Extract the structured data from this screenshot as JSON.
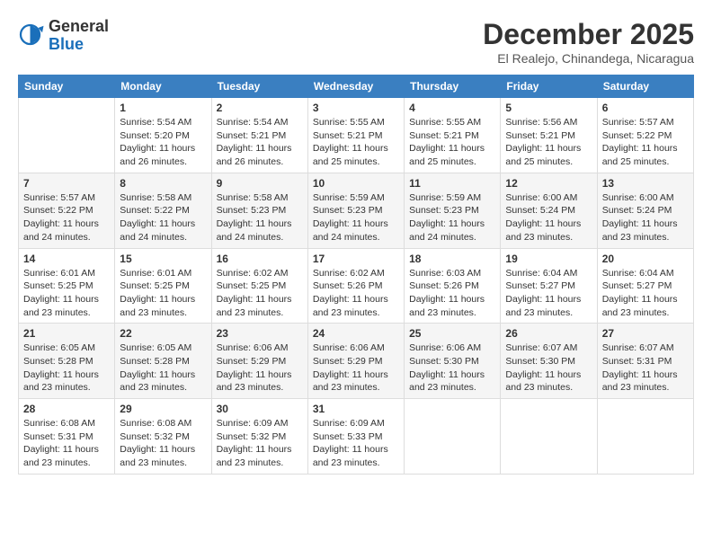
{
  "header": {
    "logo": {
      "general": "General",
      "blue": "Blue"
    },
    "title": "December 2025",
    "location": "El Realejo, Chinandega, Nicaragua"
  },
  "weekdays": [
    "Sunday",
    "Monday",
    "Tuesday",
    "Wednesday",
    "Thursday",
    "Friday",
    "Saturday"
  ],
  "weeks": [
    [
      {
        "day": "",
        "info": ""
      },
      {
        "day": "1",
        "info": "Sunrise: 5:54 AM\nSunset: 5:20 PM\nDaylight: 11 hours\nand 26 minutes."
      },
      {
        "day": "2",
        "info": "Sunrise: 5:54 AM\nSunset: 5:21 PM\nDaylight: 11 hours\nand 26 minutes."
      },
      {
        "day": "3",
        "info": "Sunrise: 5:55 AM\nSunset: 5:21 PM\nDaylight: 11 hours\nand 25 minutes."
      },
      {
        "day": "4",
        "info": "Sunrise: 5:55 AM\nSunset: 5:21 PM\nDaylight: 11 hours\nand 25 minutes."
      },
      {
        "day": "5",
        "info": "Sunrise: 5:56 AM\nSunset: 5:21 PM\nDaylight: 11 hours\nand 25 minutes."
      },
      {
        "day": "6",
        "info": "Sunrise: 5:57 AM\nSunset: 5:22 PM\nDaylight: 11 hours\nand 25 minutes."
      }
    ],
    [
      {
        "day": "7",
        "info": "Sunrise: 5:57 AM\nSunset: 5:22 PM\nDaylight: 11 hours\nand 24 minutes."
      },
      {
        "day": "8",
        "info": "Sunrise: 5:58 AM\nSunset: 5:22 PM\nDaylight: 11 hours\nand 24 minutes."
      },
      {
        "day": "9",
        "info": "Sunrise: 5:58 AM\nSunset: 5:23 PM\nDaylight: 11 hours\nand 24 minutes."
      },
      {
        "day": "10",
        "info": "Sunrise: 5:59 AM\nSunset: 5:23 PM\nDaylight: 11 hours\nand 24 minutes."
      },
      {
        "day": "11",
        "info": "Sunrise: 5:59 AM\nSunset: 5:23 PM\nDaylight: 11 hours\nand 24 minutes."
      },
      {
        "day": "12",
        "info": "Sunrise: 6:00 AM\nSunset: 5:24 PM\nDaylight: 11 hours\nand 23 minutes."
      },
      {
        "day": "13",
        "info": "Sunrise: 6:00 AM\nSunset: 5:24 PM\nDaylight: 11 hours\nand 23 minutes."
      }
    ],
    [
      {
        "day": "14",
        "info": "Sunrise: 6:01 AM\nSunset: 5:25 PM\nDaylight: 11 hours\nand 23 minutes."
      },
      {
        "day": "15",
        "info": "Sunrise: 6:01 AM\nSunset: 5:25 PM\nDaylight: 11 hours\nand 23 minutes."
      },
      {
        "day": "16",
        "info": "Sunrise: 6:02 AM\nSunset: 5:25 PM\nDaylight: 11 hours\nand 23 minutes."
      },
      {
        "day": "17",
        "info": "Sunrise: 6:02 AM\nSunset: 5:26 PM\nDaylight: 11 hours\nand 23 minutes."
      },
      {
        "day": "18",
        "info": "Sunrise: 6:03 AM\nSunset: 5:26 PM\nDaylight: 11 hours\nand 23 minutes."
      },
      {
        "day": "19",
        "info": "Sunrise: 6:04 AM\nSunset: 5:27 PM\nDaylight: 11 hours\nand 23 minutes."
      },
      {
        "day": "20",
        "info": "Sunrise: 6:04 AM\nSunset: 5:27 PM\nDaylight: 11 hours\nand 23 minutes."
      }
    ],
    [
      {
        "day": "21",
        "info": "Sunrise: 6:05 AM\nSunset: 5:28 PM\nDaylight: 11 hours\nand 23 minutes."
      },
      {
        "day": "22",
        "info": "Sunrise: 6:05 AM\nSunset: 5:28 PM\nDaylight: 11 hours\nand 23 minutes."
      },
      {
        "day": "23",
        "info": "Sunrise: 6:06 AM\nSunset: 5:29 PM\nDaylight: 11 hours\nand 23 minutes."
      },
      {
        "day": "24",
        "info": "Sunrise: 6:06 AM\nSunset: 5:29 PM\nDaylight: 11 hours\nand 23 minutes."
      },
      {
        "day": "25",
        "info": "Sunrise: 6:06 AM\nSunset: 5:30 PM\nDaylight: 11 hours\nand 23 minutes."
      },
      {
        "day": "26",
        "info": "Sunrise: 6:07 AM\nSunset: 5:30 PM\nDaylight: 11 hours\nand 23 minutes."
      },
      {
        "day": "27",
        "info": "Sunrise: 6:07 AM\nSunset: 5:31 PM\nDaylight: 11 hours\nand 23 minutes."
      }
    ],
    [
      {
        "day": "28",
        "info": "Sunrise: 6:08 AM\nSunset: 5:31 PM\nDaylight: 11 hours\nand 23 minutes."
      },
      {
        "day": "29",
        "info": "Sunrise: 6:08 AM\nSunset: 5:32 PM\nDaylight: 11 hours\nand 23 minutes."
      },
      {
        "day": "30",
        "info": "Sunrise: 6:09 AM\nSunset: 5:32 PM\nDaylight: 11 hours\nand 23 minutes."
      },
      {
        "day": "31",
        "info": "Sunrise: 6:09 AM\nSunset: 5:33 PM\nDaylight: 11 hours\nand 23 minutes."
      },
      {
        "day": "",
        "info": ""
      },
      {
        "day": "",
        "info": ""
      },
      {
        "day": "",
        "info": ""
      }
    ]
  ]
}
